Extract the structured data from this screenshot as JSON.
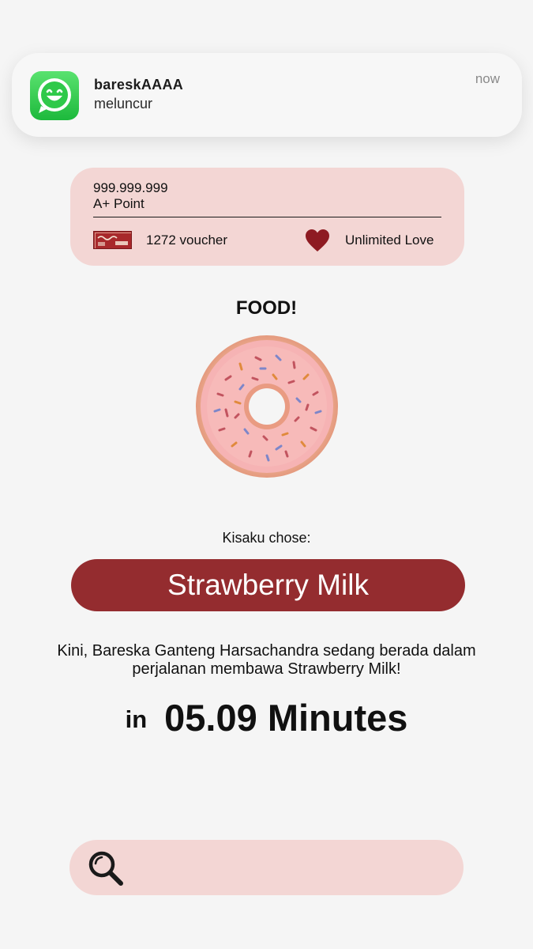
{
  "notification": {
    "app_icon": "whatsapp-smiley-icon",
    "title": "bareskAAAA",
    "body": "meluncur",
    "time": "now"
  },
  "points_card": {
    "points_value": "999.999.999",
    "points_label": "A+ Point",
    "voucher_icon": "discount-ticket-icon",
    "voucher_count": "1272 voucher",
    "love_icon": "heart-icon",
    "love_label": "Unlimited Love"
  },
  "food": {
    "title": "FOOD!",
    "image": "donut-icon",
    "chose_label": "Kisaku chose:",
    "choice": "Strawberry Milk",
    "status_message": "Kini, Bareska Ganteng Harsachandra sedang berada dalam perjalanan membawa Strawberry Milk!",
    "eta_prefix": "in",
    "eta_value": "05.09 Minutes"
  },
  "search": {
    "icon": "search-icon",
    "placeholder": "",
    "value": ""
  },
  "colors": {
    "background": "#f5f5f5",
    "card_pink": "#f3d6d4",
    "accent_red": "#942c2f",
    "heart_red": "#8e1b22",
    "app_green": "#2fc94a"
  }
}
